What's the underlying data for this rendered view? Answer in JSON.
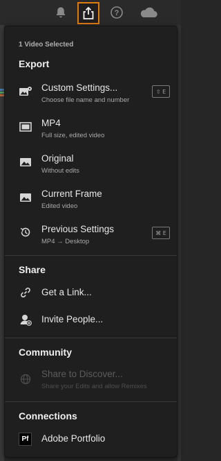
{
  "toolbar": {
    "icons": [
      "bell-icon",
      "share-icon",
      "help-icon",
      "cloud-icon"
    ],
    "accent_color": "#e27a12"
  },
  "menu": {
    "caption": "1 Video Selected",
    "export": {
      "title": "Export",
      "items": [
        {
          "label": "Custom Settings...",
          "sub": "Choose file name and number",
          "icon": "image-settings-icon",
          "shortcut": "⇧ E"
        },
        {
          "label": "MP4",
          "sub": "Full size, edited video",
          "icon": "video-frame-icon"
        },
        {
          "label": "Original",
          "sub": "Without edits",
          "icon": "image-icon"
        },
        {
          "label": "Current Frame",
          "sub": "Edited video",
          "icon": "image-icon"
        },
        {
          "label": "Previous Settings",
          "sub": "MP4 → Desktop",
          "icon": "history-icon",
          "shortcut": "⌘ E"
        }
      ]
    },
    "share": {
      "title": "Share",
      "items": [
        {
          "label": "Get a Link...",
          "icon": "link-icon"
        },
        {
          "label": "Invite People...",
          "icon": "invite-person-icon"
        }
      ]
    },
    "community": {
      "title": "Community",
      "items": [
        {
          "label": "Share to Discover...",
          "sub": "Share your Edits and allow Remixes",
          "icon": "globe-icon",
          "disabled": true
        }
      ]
    },
    "connections": {
      "title": "Connections",
      "items": [
        {
          "label": "Adobe Portfolio",
          "icon_text": "Pf"
        }
      ]
    }
  }
}
